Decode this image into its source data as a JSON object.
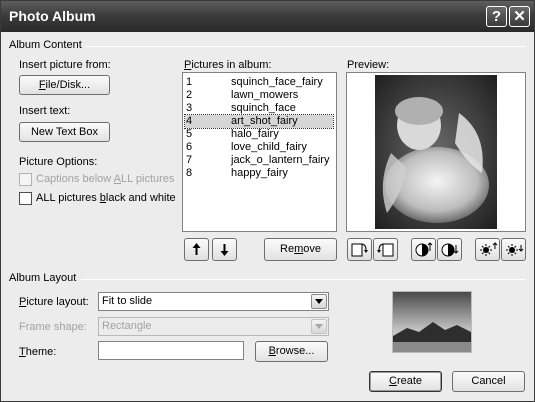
{
  "window": {
    "title": "Photo Album"
  },
  "titlebar": {
    "help_glyph": "?",
    "close_glyph": "✕"
  },
  "album_content": {
    "group_label": "Album Content",
    "insert_picture_label": "Insert picture from:",
    "file_disk_button": {
      "pre": "",
      "hot": "F",
      "post": "ile/Disk..."
    },
    "insert_text_label": "Insert text:",
    "new_text_box_button": "New Text Box",
    "picture_options_label": "Picture Options:",
    "captions_option": {
      "pre": "Captions below ",
      "hot": "A",
      "post": "LL pictures",
      "checked": false,
      "enabled": false
    },
    "bw_option": {
      "pre": "ALL pictures ",
      "hot": "b",
      "post": "lack and white",
      "checked": false,
      "enabled": true
    },
    "pictures_label": {
      "pre": "",
      "hot": "P",
      "post": "ictures in album:"
    },
    "pictures": [
      {
        "num": "1",
        "name": "squinch_face_fairy",
        "selected": false
      },
      {
        "num": "2",
        "name": "lawn_mowers",
        "selected": false
      },
      {
        "num": "3",
        "name": "squinch_face",
        "selected": false
      },
      {
        "num": "4",
        "name": "art_shot_fairy",
        "selected": true
      },
      {
        "num": "5",
        "name": "halo_fairy",
        "selected": false
      },
      {
        "num": "6",
        "name": "love_child_fairy",
        "selected": false
      },
      {
        "num": "7",
        "name": "jack_o_lantern_fairy",
        "selected": false
      },
      {
        "num": "8",
        "name": "happy_fairy",
        "selected": false
      }
    ],
    "remove_button": {
      "pre": "Re",
      "hot": "m",
      "post": "ove"
    },
    "preview_label": "Preview:"
  },
  "album_layout": {
    "group_label": "Album Layout",
    "picture_layout_label": {
      "pre": "",
      "hot": "P",
      "post": "icture layout:"
    },
    "picture_layout_value": "Fit to slide",
    "frame_shape_label": "Frame shape:",
    "frame_shape_value": "Rectangle",
    "theme_label": {
      "pre": "",
      "hot": "T",
      "post": "heme:"
    },
    "theme_value": "",
    "browse_button": {
      "pre": "",
      "hot": "B",
      "post": "rowse..."
    }
  },
  "footer": {
    "create_button": {
      "pre": "",
      "hot": "C",
      "post": "reate"
    },
    "cancel_button": "Cancel"
  }
}
